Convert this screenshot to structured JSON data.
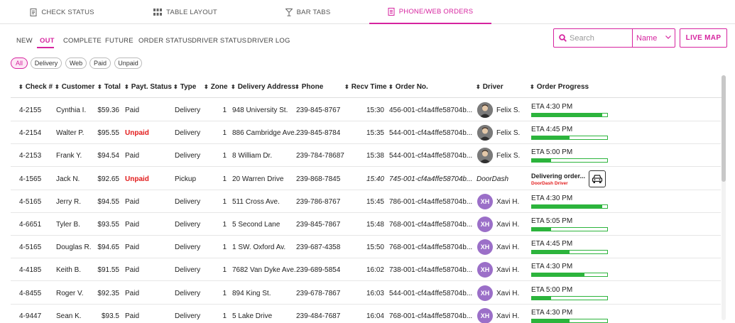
{
  "top_tabs": [
    {
      "label": "CHECK STATUS",
      "icon": "receipt-icon"
    },
    {
      "label": "TABLE LAYOUT",
      "icon": "grid-icon"
    },
    {
      "label": "BAR TABS",
      "icon": "cocktail-icon"
    },
    {
      "label": "PHONE/WEB ORDERS",
      "icon": "document-icon",
      "active": true
    }
  ],
  "sub_tabs": [
    "NEW",
    "OUT",
    "COMPLETE",
    "FUTURE",
    "ORDER STATUS",
    "DRIVER STATUS",
    "DRIVER LOG"
  ],
  "active_sub_tab": "OUT",
  "search": {
    "placeholder": "Search",
    "select_value": "Name"
  },
  "live_map_label": "LIVE MAP",
  "filter_chips": [
    "All",
    "Delivery",
    "Web",
    "Paid",
    "Unpaid"
  ],
  "columns": [
    "Check #",
    "Customer",
    "Total",
    "Payt. Status",
    "Type",
    "Zone",
    "Delivery Address",
    "Phone",
    "Recv Time",
    "Order No.",
    "Driver",
    "Order Progress"
  ],
  "rows": [
    {
      "check": "4-2155",
      "customer": "Cynthia I.",
      "total": "$59.36",
      "status": "Paid",
      "type": "Delivery",
      "zone": "1",
      "address": "948 University St.",
      "phone": "239-845-8767",
      "time": "15:30",
      "order": "456-001-cf4a4ffe58704b...",
      "driver": "Felix S.",
      "avatar": "photo",
      "eta": "ETA 4:30 PM",
      "progress": 0.93
    },
    {
      "check": "4-2154",
      "customer": "Walter P.",
      "total": "$95.55",
      "status": "Unpaid",
      "type": "Delivery",
      "zone": "1",
      "address": "886 Cambridge Ave.",
      "phone": "239-845-8784",
      "time": "15:35",
      "order": "544-001-cf4a4ffe58704b...",
      "driver": "Felix S.",
      "avatar": "photo",
      "eta": "ETA 4:45 PM",
      "progress": 0.5
    },
    {
      "check": "4-2153",
      "customer": "Frank Y.",
      "total": "$94.54",
      "status": "Paid",
      "type": "Delivery",
      "zone": "1",
      "address": "8 William Dr.",
      "phone": "239-784-78687",
      "time": "15:38",
      "order": "544-001-cf4a4ffe58704b...",
      "driver": "Felix S.",
      "avatar": "photo",
      "eta": "ETA 5:00 PM",
      "progress": 0.25
    },
    {
      "check": "4-1565",
      "customer": "Jack N.",
      "total": "$92.65",
      "status": "Unpaid",
      "type": "Pickup",
      "zone": "1",
      "address": "20 Warren Drive",
      "phone": "239-868-7845",
      "time": "15:40",
      "order": "745-001-cf4a4ffe58704b...",
      "driver": "DoorDash",
      "avatar": "none",
      "delivering": "Delivering order...",
      "delivering_sub": "DoorDash Driver"
    },
    {
      "check": "4-5165",
      "customer": "Jerry R.",
      "total": "$94.55",
      "status": "Paid",
      "type": "Delivery",
      "zone": "1",
      "address": "511 Cross Ave.",
      "phone": "239-786-8767",
      "time": "15:45",
      "order": "786-001-cf4a4ffe58704b...",
      "driver": "Xavi H.",
      "avatar": "XH",
      "eta": "ETA 4:30 PM",
      "progress": 0.93
    },
    {
      "check": "4-6651",
      "customer": "Tyler B.",
      "total": "$93.55",
      "status": "Paid",
      "type": "Delivery",
      "zone": "1",
      "address": "5 Second Lane",
      "phone": "239-845-7867",
      "time": "15:48",
      "order": "768-001-cf4a4ffe58704b...",
      "driver": "Xavi H.",
      "avatar": "XH",
      "eta": "ETA 5:05 PM",
      "progress": 0.25
    },
    {
      "check": "4-5165",
      "customer": "Douglas R.",
      "total": "$94.65",
      "status": "Paid",
      "type": "Delivery",
      "zone": "1",
      "address": "1 SW. Oxford Av.",
      "phone": "239-687-4358",
      "time": "15:50",
      "order": "768-001-cf4a4ffe58704b...",
      "driver": "Xavi H.",
      "avatar": "XH",
      "eta": "ETA 4:45 PM",
      "progress": 0.5
    },
    {
      "check": "4-4185",
      "customer": "Keith B.",
      "total": "$91.55",
      "status": "Paid",
      "type": "Delivery",
      "zone": "1",
      "address": "7682 Van Dyke Ave.",
      "phone": "239-689-5854",
      "time": "16:02",
      "order": "738-001-cf4a4ffe58704b...",
      "driver": "Xavi H.",
      "avatar": "XH",
      "eta": "ETA 4:30 PM",
      "progress": 0.7
    },
    {
      "check": "4-8455",
      "customer": "Roger V.",
      "total": "$92.35",
      "status": "Paid",
      "type": "Delivery",
      "zone": "1",
      "address": "894 King St.",
      "phone": "239-678-7867",
      "time": "16:03",
      "order": "544-001-cf4a4ffe58704b...",
      "driver": "Xavi H.",
      "avatar": "XH",
      "eta": "ETA 5:00 PM",
      "progress": 0.25
    },
    {
      "check": "4-9447",
      "customer": "Sean K.",
      "total": "$93.5",
      "status": "Paid",
      "type": "Delivery",
      "zone": "1",
      "address": "5 Lake Drive",
      "phone": "239-484-7687",
      "time": "16:04",
      "order": "768-001-cf4a4ffe58704b...",
      "driver": "Xavi H.",
      "avatar": "XH",
      "eta": "ETA 4:30 PM",
      "progress": 0.5
    }
  ],
  "colors": {
    "accent": "#d6249f",
    "progress": "#2cb43c",
    "unpaid": "#e21b1b",
    "avatar": "#9b6fc8"
  }
}
